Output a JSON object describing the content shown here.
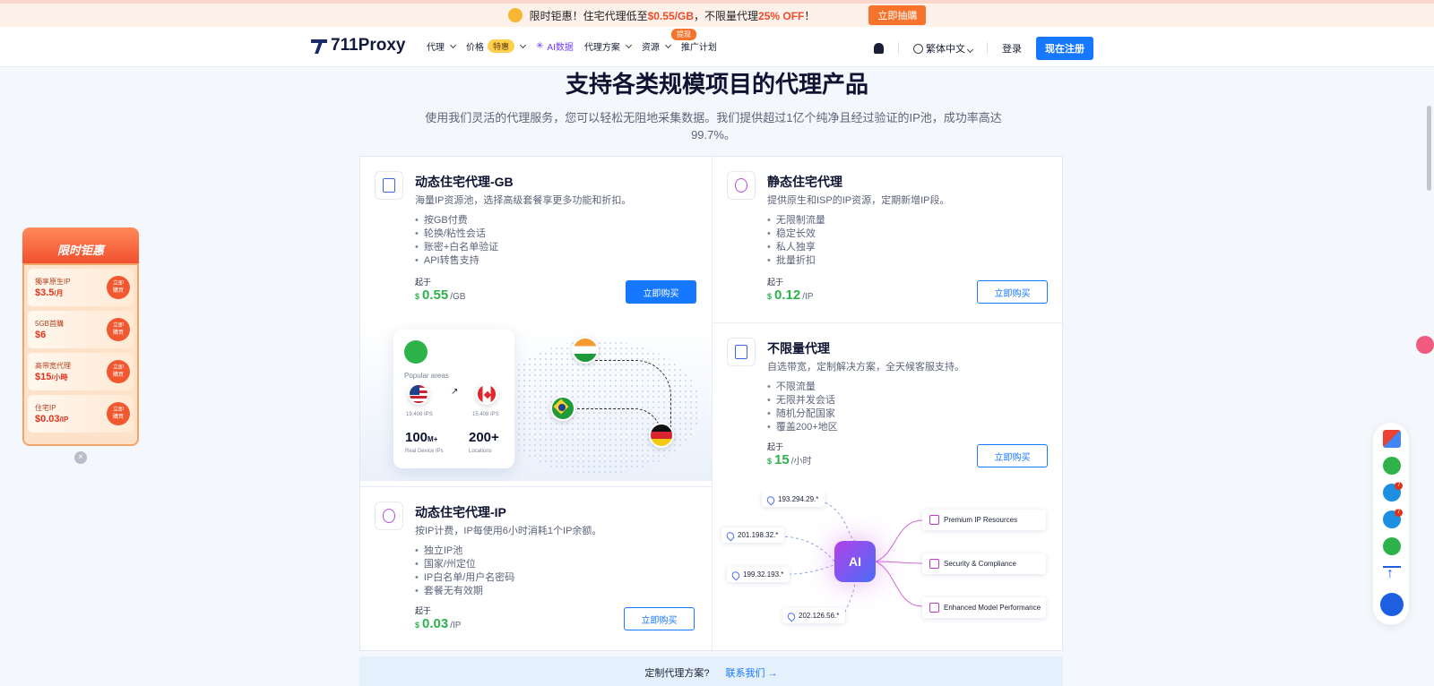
{
  "promo": {
    "text1": "限时钜惠！住宅代理低至",
    "price": "$0.55/GB",
    "text2": "，不限量代理",
    "discount": "25% OFF",
    "text3": "！",
    "button": "立即抽購"
  },
  "nav": {
    "brand": "711Proxy",
    "items": [
      "代理",
      "价格",
      "AI数据",
      "代理方案",
      "资源",
      "推广计划"
    ],
    "hot_badge": "特惠",
    "promo_tag": "提现",
    "language": "繁体中文",
    "login": "登录",
    "register": "现在注册"
  },
  "hero": {
    "title": "支持各类规模项目的代理产品",
    "subtitle": "使用我们灵活的代理服务，您可以轻松无阻地采集数据。我们提供超过1亿个纯净且经过验证的IP池，成功率高达99.7%。"
  },
  "cards": {
    "dyn_gb": {
      "title": "动态住宅代理-GB",
      "desc": "海量IP资源池，选择高级套餐享更多功能和折扣。",
      "features": [
        "按GB付费",
        "轮换/粘性会话",
        "账密+白名单验证",
        "API转售支持"
      ],
      "from": "起于",
      "currency": "$",
      "price": "0.55",
      "unit": "/GB",
      "button": "立即购买"
    },
    "static": {
      "title": "静态住宅代理",
      "desc": "提供原生和ISP的IP资源，定期新增IP段。",
      "features": [
        "无限制流量",
        "稳定长效",
        "私人独享",
        "批量折扣"
      ],
      "from": "起于",
      "currency": "$",
      "price": "0.12",
      "unit": "/IP",
      "button": "立即购买"
    },
    "unlimited": {
      "title": "不限量代理",
      "desc": "自选带宽，定制解决方案，全天候客服支持。",
      "features": [
        "不限流量",
        "无限并发会话",
        "随机分配国家",
        "覆盖200+地区"
      ],
      "from": "起于",
      "currency": "$",
      "price": "15",
      "unit": "/小时",
      "button": "立即购买"
    },
    "dyn_ip": {
      "title": "动态住宅代理-IP",
      "desc": "按IP计费，IP每使用6小时消耗1个IP余额。",
      "features": [
        "独立IP池",
        "国家/州定位",
        "IP白名单/用户名密码",
        "套餐无有效期"
      ],
      "from": "起于",
      "currency": "$",
      "price": "0.03",
      "unit": "/IP",
      "button": "立即购买"
    }
  },
  "map_widget": {
    "popular": "Popular areas",
    "arrow": "↗",
    "ips_left": "19,408 IPS",
    "ips_right": "15,408 IPS",
    "stat1": "100",
    "stat1_suffix": "M+",
    "stat1_label": "Real Device IPs",
    "stat2": "200+",
    "stat2_label": "Locations"
  },
  "ai_widget": {
    "chip": "AI",
    "ips": [
      "193.294.29.*",
      "201.198.32.*",
      "199.32.193.*",
      "202.126.56.*"
    ],
    "features": [
      "Premium IP Resources",
      "Security & Compliance",
      "Enhanced Model Performance"
    ]
  },
  "custom": {
    "text": "定制代理方案?",
    "link": "联系我们",
    "arrow": "→"
  },
  "left_promo": {
    "title": "限时钜惠",
    "items": [
      {
        "name": "獨享原生IP",
        "price": "$3.5",
        "unit": "/月"
      },
      {
        "name": "5GB首購",
        "price": "$6",
        "unit": ""
      },
      {
        "name": "高带宽代理",
        "price": "$15",
        "unit": "/小時"
      },
      {
        "name": "住宅IP",
        "price": "$0.03",
        "unit": "/IP"
      }
    ],
    "go": "立即\n購買",
    "close": "×"
  },
  "rail": {
    "badge": "7"
  },
  "colors": {
    "primary": "#1677ff",
    "price": "#2db34a",
    "accent": "#f5732b"
  }
}
